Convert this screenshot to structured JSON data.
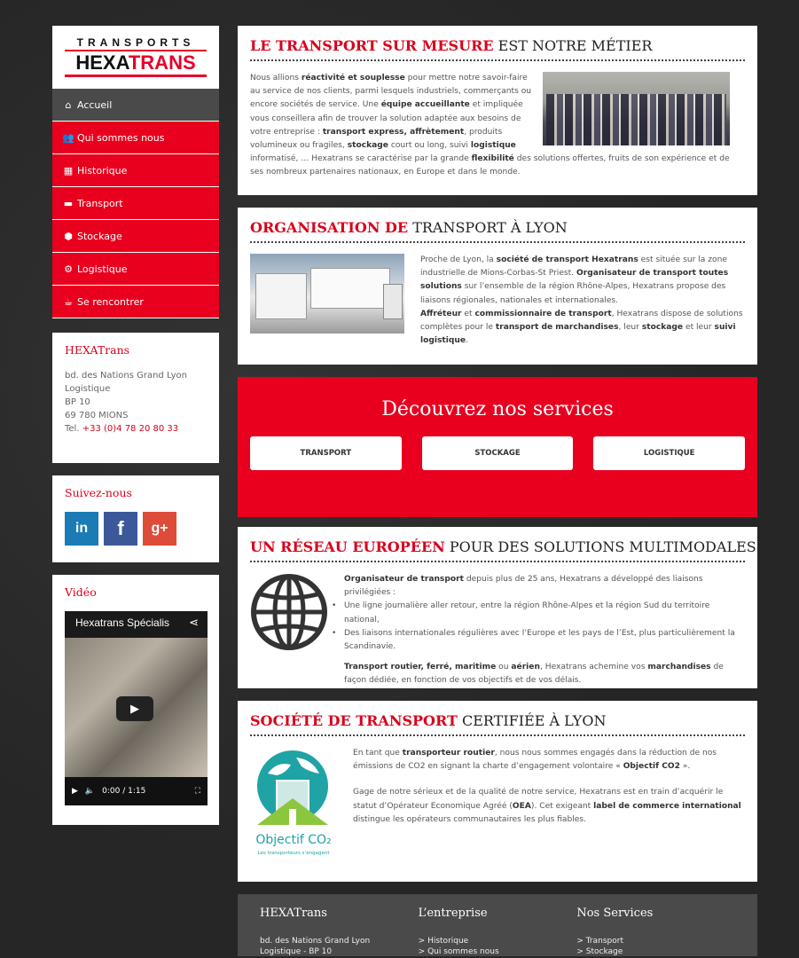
{
  "logo": {
    "top": "TRANSPORTS",
    "hexa": "HEXA",
    "trans": "TRANS"
  },
  "nav": [
    {
      "label": "Accueil",
      "icon": "⌂",
      "name": "home-icon"
    },
    {
      "label": "Qui sommes nous",
      "icon": "👥",
      "name": "users-icon"
    },
    {
      "label": "Historique",
      "icon": "▦",
      "name": "calendar-icon"
    },
    {
      "label": "Transport",
      "icon": "▬",
      "name": "truck-icon"
    },
    {
      "label": "Stockage",
      "icon": "⬢",
      "name": "dropbox-icon"
    },
    {
      "label": "Logistique",
      "icon": "⚙",
      "name": "gears-icon"
    },
    {
      "label": "Se rencontrer",
      "icon": "☕",
      "name": "coffee-icon"
    }
  ],
  "contact": {
    "title": "HEXATrans",
    "line1": "bd. des Nations Grand Lyon",
    "line2": "Logistique",
    "line3": "BP 10",
    "line4": "69 780 MIONS",
    "tel_label": "Tel. ",
    "tel": "+33 (0)4 78 20 80 33"
  },
  "social": {
    "title": "Suivez-nous"
  },
  "video": {
    "title": "Vidéo",
    "player_title": "Hexatrans Spécialis",
    "time": "0:00 / 1:15"
  },
  "section1": {
    "hl": "LE TRANSPORT SUR MESURE",
    "rest": " EST NOTRE MÉTIER",
    "text": [
      "Nous allions ",
      "réactivité et souplesse",
      " pour mettre notre savoir-faire au service de nos clients, parmi lesquels industriels, commerçants ou encore sociétés de service. Une ",
      "équipe accueillante",
      " et impliquée vous conseillera afin de trouver la solution adaptée aux besoins de votre entreprise : ",
      "transport express, affrètement",
      ", produits volumineux ou fragiles, ",
      "stockage",
      " court ou long, suivi ",
      "logistique",
      " informatisé, … Hexatrans se caractérise par la grande ",
      "flexibilité",
      " des solutions offertes, fruits de son expérience et de ses nombreux partenaires nationaux, en Europe et dans le monde."
    ]
  },
  "section2": {
    "hl": "ORGANISATION DE",
    "rest": " TRANSPORT À LYON",
    "text": [
      "Proche de Lyon, la ",
      "société de transport Hexatrans",
      " est située sur la zone industrielle de Mions-Corbas-St Priest. ",
      "Organisateur de transport toutes solutions",
      " sur l’ensemble de la région Rhône-Alpes, Hexatrans propose des liaisons régionales, nationales et internationales.",
      "Affréteur",
      " et ",
      "commissionnaire de transport",
      ", Hexatrans dispose de solutions complètes pour le ",
      "transport de marchandises",
      ", leur ",
      "stockage",
      " et leur ",
      "suivi logistique",
      "."
    ]
  },
  "services": {
    "title": "Découvrez nos services",
    "buttons": [
      "TRANSPORT",
      "STOCKAGE",
      "LOGISTIQUE"
    ]
  },
  "section3": {
    "hl": "UN RÉSEAU EUROPÉEN",
    "rest": " POUR DES SOLUTIONS MULTIMODALES",
    "intro_b": "Organisateur de transport",
    "intro": " depuis plus de 25 ans, Hexatrans a développé des liaisons privilégiées :",
    "items": [
      "Une ligne journalière aller retour, entre la région Rhône-Alpes et la région Sud du territoire national,",
      "Des liaisons internationales régulières avec l’Europe et les pays de l’Est, plus particulièrement la Scandinavie."
    ],
    "p2": [
      "Transport routier, ferré, maritime",
      " ou ",
      "aérien",
      ", Hexatrans achemine vos ",
      "marchandises",
      " de façon dédiée, en fonction de vos objectifs et de vos délais."
    ]
  },
  "section4": {
    "hl": "SOCIÉTÉ DE TRANSPORT",
    "rest": " CERTIFIÉE À LYON",
    "p1": [
      "En tant que ",
      "transporteur routier",
      ", nous nous sommes engagés dans la réduction de nos émissions de CO2 en signant la charte d’engagement volontaire « ",
      "Objectif CO2",
      " »."
    ],
    "p2": [
      "Gage de notre sérieux et de la qualité de notre service, Hexatrans est en train d’acquérir le statut d’Opérateur Economique Agréé (",
      "OEA",
      "). Cet exigeant ",
      "label de commerce international",
      " distingue les opérateurs communautaires les plus fiables."
    ],
    "logo_text": "Objectif CO₂",
    "logo_sub": "Les transporteurs s’engagent"
  },
  "footer": {
    "col1": {
      "title": "HEXATrans",
      "line": "bd. des Nations Grand Lyon",
      "line2": "Logistique - BP 10"
    },
    "col2": {
      "title": "L’entreprise",
      "line": "> Historique",
      "line2": "> Qui sommes nous"
    },
    "col3": {
      "title": "Nos Services",
      "line": "> Transport",
      "line2": "> Stockage"
    }
  },
  "colors": {
    "accent": "#e8001e",
    "dark": "#4a4a4a"
  }
}
